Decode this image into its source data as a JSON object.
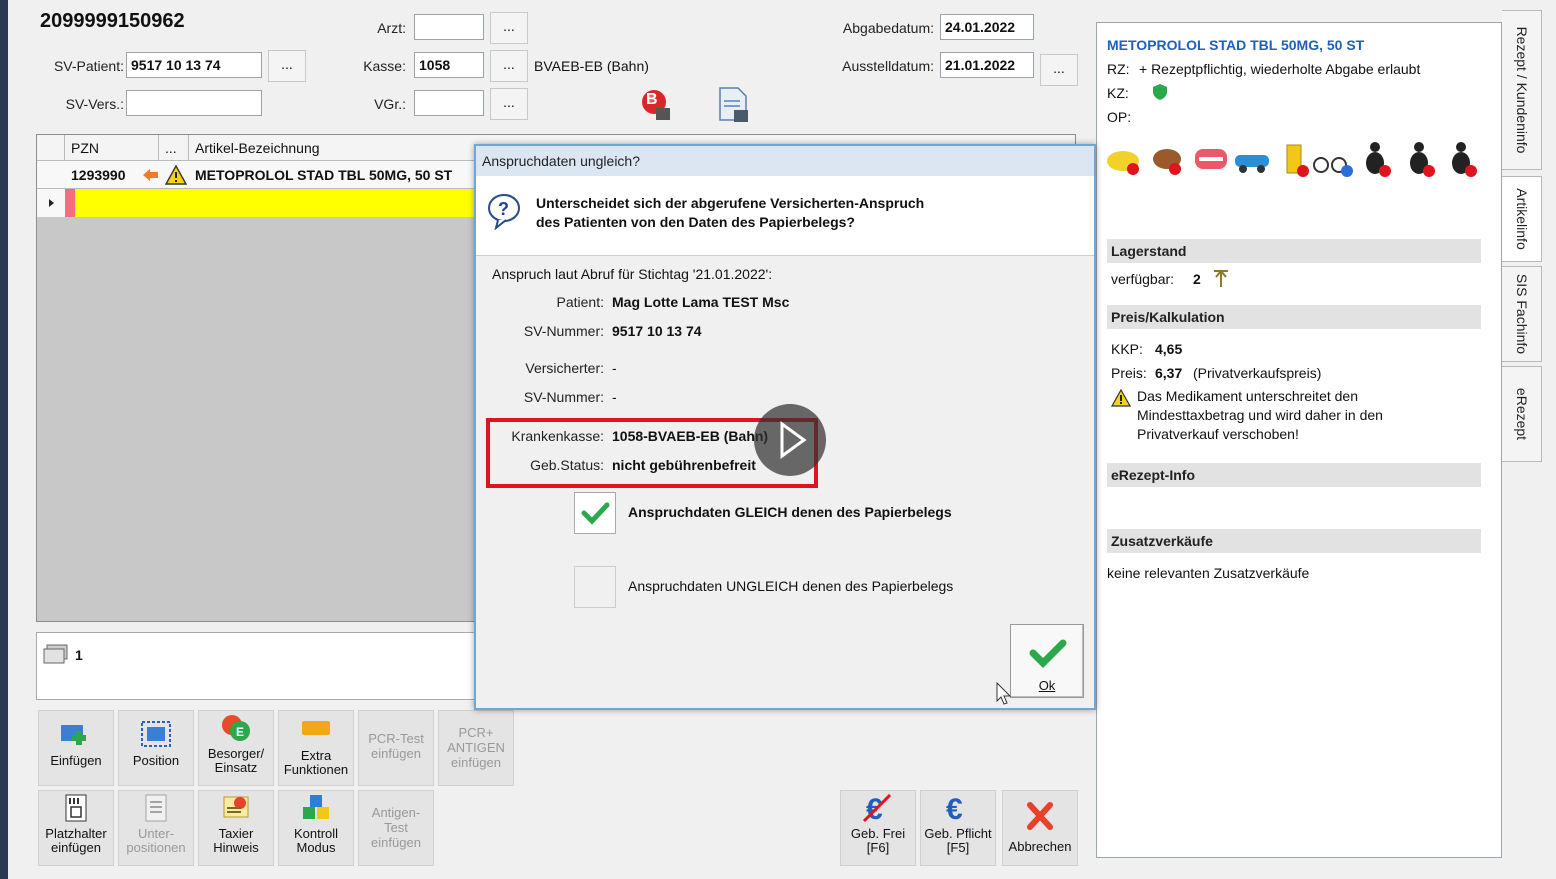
{
  "header": {
    "number": "2099999150962",
    "sv_patient_label": "SV-Patient:",
    "sv_patient_value": "9517 10 13 74",
    "sv_vers_label": "SV-Vers.:",
    "arzt_label": "Arzt:",
    "kasse_label": "Kasse:",
    "kasse_value": "1058",
    "kasse_name": "BVAEB-EB (Bahn)",
    "vgr_label": "VGr.:",
    "abgabedatum_label": "Abgabedatum:",
    "abgabedatum_value": "24.01.2022",
    "ausstelldatum_label": "Ausstelldatum:",
    "ausstelldatum_value": "21.01.2022",
    "dots": "...",
    "badge_b": "B"
  },
  "table": {
    "col_pzn": "PZN",
    "col_dots": "...",
    "col_name": "Artikel-Bezeichnung",
    "rows": [
      {
        "pzn": "1293990",
        "name": "METOPROLOL STAD TBL  50MG, 50 ST"
      }
    ]
  },
  "counter": "1",
  "buttons": {
    "einfuegen": "Einfügen",
    "position": "Position",
    "besorger": "Besorger/\nEinsatz",
    "extra": "Extra\nFunktionen",
    "pcr_test": "PCR-Test\neinfügen",
    "pcr_antigen": "PCR+\nANTIGEN\neinfügen",
    "platzhalter": "Platzhalter\neinfügen",
    "unterpos": "Unter-\npositionen",
    "taxier": "Taxier\nHinweis",
    "kontroll": "Kontroll\nModus",
    "antigen": "Antigen-\nTest\neinfügen",
    "geb_frei": "Geb. Frei\n[F6]",
    "geb_pflicht": "Geb. Pflicht\n[F5]",
    "abbrechen": "Abbrechen"
  },
  "dialog": {
    "title": "Anspruchdaten ungleich?",
    "question": "Unterscheidet sich der abgerufene Versicherten-Anspruch\ndes Patienten von den Daten des Papierbelegs?",
    "stichtag": "Anspruch laut Abruf für Stichtag '21.01.2022':",
    "patient_label": "Patient:",
    "patient_value": "Mag Lotte Lama TEST Msc",
    "svnr_label": "SV-Nummer:",
    "svnr_value": "9517 10 13 74",
    "versicherter_label": "Versicherter:",
    "versicherter_value": "-",
    "svnr2_label": "SV-Nummer:",
    "svnr2_value": "-",
    "kk_label": "Krankenkasse:",
    "kk_value": "1058-BVAEB-EB (Bahn)",
    "geb_label": "Geb.Status:",
    "geb_value": "nicht gebührenbefreit",
    "option_gleich": "Anspruchdaten GLEICH denen des Papierbelegs",
    "option_ungleich": "Anspruchdaten UNGLEICH denen des Papierbelegs",
    "ok_label": "Ok"
  },
  "artikel": {
    "title": "METOPROLOL STAD TBL  50MG, 50 ST",
    "rz_label": "RZ:",
    "rz_value": "+  Rezeptpflichtig, wiederholte Abgabe erlaubt",
    "kz_label": "KZ:",
    "op_label": "OP:",
    "lagerstand_title": "Lagerstand",
    "verfuegbar_label": "verfügbar:",
    "verfuegbar_value": "2",
    "preis_title": "Preis/Kalkulation",
    "kkp_label": "KKP:",
    "kkp_value": "4,65",
    "preis_label": "Preis:",
    "preis_value": "6,37",
    "preis_note": "(Privatverkaufspreis)",
    "warning": "Das Medikament unterschreitet den Mindesttaxbetrag und wird daher in den Privatverkauf verschoben!",
    "erezept_title": "eRezept-Info",
    "zusatz_title": "Zusatzverkäufe",
    "zusatz_value": "keine relevanten Zusatzverkäufe"
  },
  "side_tabs": [
    "Rezept / Kundeninfo",
    "Artikelinfo",
    "SIS Fachinfo",
    "eRezept"
  ],
  "colors": {
    "highlight_box": "#e0141e",
    "link_blue": "#1f5fbf",
    "row_yellow": "#ffff00"
  }
}
